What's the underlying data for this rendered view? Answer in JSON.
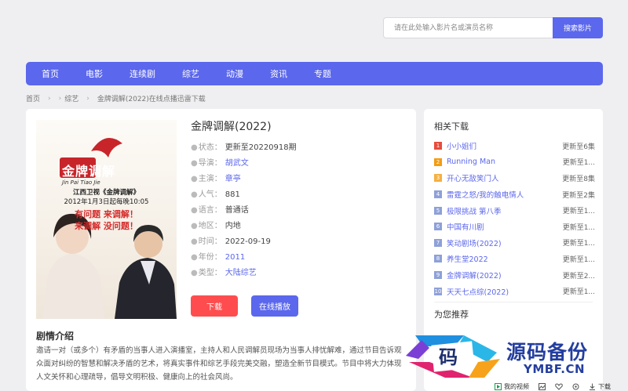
{
  "search": {
    "placeholder": "请在此处输入影片名或演员名称",
    "button": "搜索影片"
  },
  "nav": [
    "首页",
    "电影",
    "连续剧",
    "综艺",
    "动漫",
    "资讯",
    "专题"
  ],
  "breadcrumb": {
    "home": "首页",
    "category": "综艺",
    "current": "金牌调解(2022)在线点播迅雷下载"
  },
  "poster": {
    "brand_cn": "金牌调解",
    "brand_py": "Jin Pai Tiao Jie",
    "line1": "江西卫视《金牌调解》",
    "line2": "2012年1月3日起每晚10:05",
    "slogan1": "有问题 来调解！",
    "slogan2": "来调解 没问题！"
  },
  "detail": {
    "title": "金牌调解(2022)",
    "rows": [
      {
        "key": "状态：",
        "value": "更新至20220918期"
      },
      {
        "key": "导演：",
        "value": "胡武文"
      },
      {
        "key": "主演：",
        "value": "章亭"
      },
      {
        "key": "人气：",
        "value": "881"
      },
      {
        "key": "语言：",
        "value": "普通话"
      },
      {
        "key": "地区：",
        "value": "内地"
      },
      {
        "key": "时间：",
        "value": "2022-09-19"
      },
      {
        "key": "年份：",
        "value": "2011"
      },
      {
        "key": "类型：",
        "value": "大陆综艺"
      }
    ],
    "download": "下载",
    "play": "在线播放"
  },
  "intro": {
    "heading": "剧情介绍",
    "text": "邀请一对（或多个）有矛盾的当事人进入演播室，主持人和人民调解员现场为当事人排忧解难，通过节目告诉观众面对纠纷的智慧和解决矛盾的艺术，将真实事件和综艺手段完美交融，塑造全新节目模式。节目中将大力体现人文关怀和心理疏导，倡导文明积极、健康向上的社会风尚。"
  },
  "sidebar": {
    "related_title": "相关下载",
    "related": [
      {
        "num": "1",
        "name": "小小姐们",
        "status": "更新至6集",
        "color": "#e74c3c"
      },
      {
        "num": "2",
        "name": "Running Man",
        "status": "更新至1...",
        "color": "#f39c12"
      },
      {
        "num": "3",
        "name": "开心无敌笑门人",
        "status": "更新至8集",
        "color": "#f5b041"
      },
      {
        "num": "4",
        "name": "雷霆之怒/我的触电情人",
        "status": "更新至2集",
        "color": "#8ea0d8"
      },
      {
        "num": "5",
        "name": "极限挑战 第八季",
        "status": "更新至1...",
        "color": "#8ea0d8"
      },
      {
        "num": "6",
        "name": "中国有川剧",
        "status": "更新至1...",
        "color": "#8ea0d8"
      },
      {
        "num": "7",
        "name": "笑动剧场(2022)",
        "status": "更新至1...",
        "color": "#8ea0d8"
      },
      {
        "num": "8",
        "name": "养生堂2022",
        "status": "更新至1...",
        "color": "#8ea0d8"
      },
      {
        "num": "9",
        "name": "金牌调解(2022)",
        "status": "更新至2...",
        "color": "#8ea0d8"
      },
      {
        "num": "10",
        "name": "天天七点综(2022)",
        "status": "更新至1...",
        "color": "#8ea0d8"
      }
    ],
    "recommend_title": "为您推荐"
  },
  "watermark": {
    "glyph": "码",
    "title": "源码备份",
    "domain": "YMBF.CN"
  },
  "bottombar": {
    "my_video": "我的视频",
    "download": "下载"
  },
  "colors": {
    "accent": "#5b67ec",
    "download_button": "#ff4d4f",
    "background": "#efeff1"
  }
}
